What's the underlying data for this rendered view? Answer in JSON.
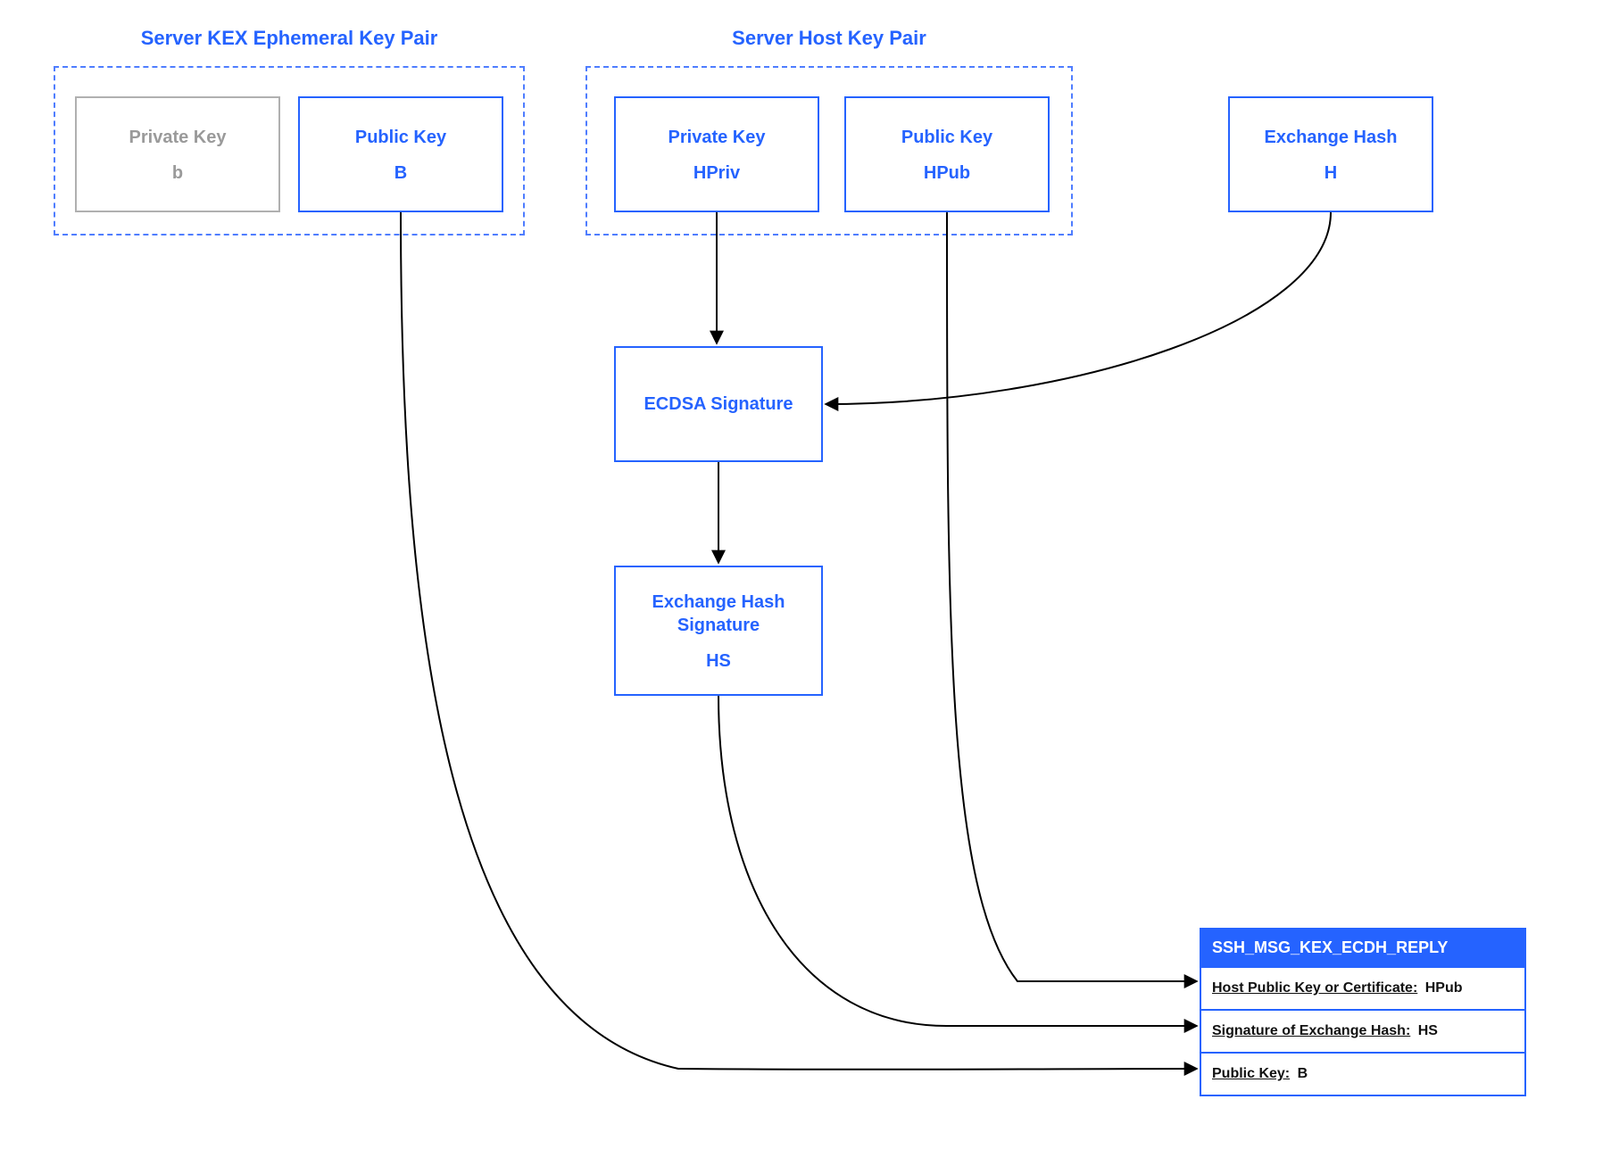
{
  "groups": {
    "kex": {
      "title": "Server KEX Ephemeral Key Pair"
    },
    "host": {
      "title": "Server Host Key Pair"
    }
  },
  "nodes": {
    "kex_priv": {
      "title": "Private Key",
      "sub": "b"
    },
    "kex_pub": {
      "title": "Public Key",
      "sub": "B"
    },
    "host_priv": {
      "title": "Private Key",
      "sub": "HPriv"
    },
    "host_pub": {
      "title": "Public Key",
      "sub": "HPub"
    },
    "exch_hash": {
      "title": "Exchange Hash",
      "sub": "H"
    },
    "ecdsa": {
      "title": "ECDSA Signature"
    },
    "hash_sig": {
      "title": "Exchange Hash Signature",
      "sub": "HS"
    }
  },
  "reply": {
    "header": "SSH_MSG_KEX_ECDH_REPLY",
    "rows": [
      {
        "label": "Host Public Key or Certificate:",
        "value": "HPub"
      },
      {
        "label": "Signature of Exchange Hash:",
        "value": "HS"
      },
      {
        "label": "Public Key:",
        "value": "B"
      }
    ]
  }
}
